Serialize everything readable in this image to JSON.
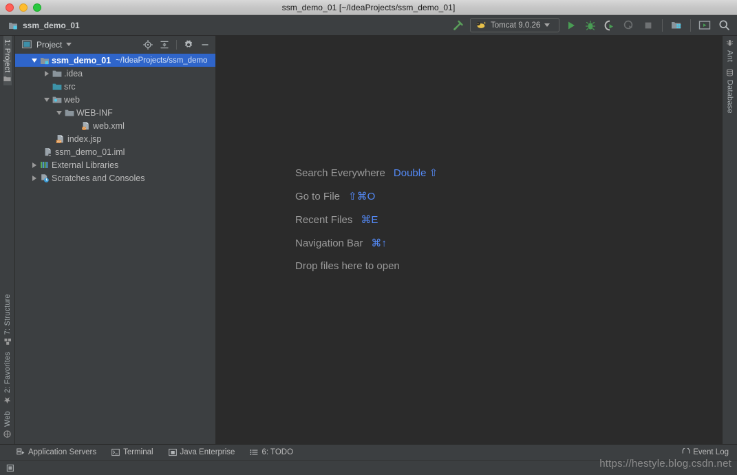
{
  "window": {
    "title": "ssm_demo_01 [~/IdeaProjects/ssm_demo_01]",
    "traffic_lights": [
      "close-red",
      "minimize-yellow",
      "zoom-green"
    ]
  },
  "toolbar": {
    "breadcrumb": "ssm_demo_01",
    "run_config": "Tomcat 9.0.26",
    "icons": [
      "build-hammer-icon",
      "run-icon",
      "debug-icon",
      "run-coverage-icon",
      "profile-icon",
      "stop-icon",
      "project-structure-icon",
      "console-icon",
      "search-icon"
    ]
  },
  "left_stripe": {
    "top": [
      {
        "label": "1: Project",
        "active": true
      }
    ],
    "bottom": [
      {
        "label": "Web"
      },
      {
        "label": "2: Favorites"
      },
      {
        "label": "7: Structure"
      }
    ]
  },
  "right_stripe": {
    "top": [
      {
        "label": "Ant"
      },
      {
        "label": "Database"
      }
    ]
  },
  "project_panel": {
    "title": "Project",
    "header_icons": [
      "locate-target-icon",
      "collapse-all-icon",
      "gear-icon",
      "hide-minimize-icon"
    ],
    "tree": [
      {
        "label": "ssm_demo_01",
        "sub": "~/IdeaProjects/ssm_demo",
        "icon": "module-icon",
        "indent": 0,
        "arrow": "down",
        "selected": true,
        "bold": true
      },
      {
        "label": ".idea",
        "icon": "folder-icon",
        "indent": 1,
        "arrow": "right"
      },
      {
        "label": "src",
        "icon": "source-folder-icon",
        "indent": 1,
        "arrow": "none"
      },
      {
        "label": "web",
        "icon": "web-folder-icon",
        "indent": 1,
        "arrow": "down"
      },
      {
        "label": "WEB-INF",
        "icon": "folder-icon",
        "indent": 2,
        "arrow": "down"
      },
      {
        "label": "web.xml",
        "icon": "xml-file-icon",
        "indent": 3,
        "arrow": "none"
      },
      {
        "label": "index.jsp",
        "icon": "jsp-file-icon",
        "indent": 2,
        "arrow": "none"
      },
      {
        "label": "ssm_demo_01.iml",
        "icon": "iml-file-icon",
        "indent": 1,
        "arrow": "none"
      },
      {
        "label": "External Libraries",
        "icon": "libraries-icon",
        "indent": 0,
        "arrow": "right"
      },
      {
        "label": "Scratches and Consoles",
        "icon": "scratches-icon",
        "indent": 0,
        "arrow": "right"
      }
    ]
  },
  "editor": {
    "hints": [
      {
        "label": "Search Everywhere",
        "key": "Double ⇧"
      },
      {
        "label": "Go to File",
        "key": "⇧⌘O"
      },
      {
        "label": "Recent Files",
        "key": "⌘E"
      },
      {
        "label": "Navigation Bar",
        "key": "⌘↑"
      },
      {
        "label": "Drop files here to open",
        "key": ""
      }
    ]
  },
  "toolwindow_bar": {
    "items": [
      {
        "label": "Application Servers",
        "icon": "application-servers-icon"
      },
      {
        "label": "Terminal",
        "icon": "terminal-icon"
      },
      {
        "label": "Java Enterprise",
        "icon": "java-enterprise-icon"
      },
      {
        "label": "6: TODO",
        "icon": "todo-icon"
      }
    ],
    "event_log": "Event Log"
  },
  "status_bar": {
    "left_icon": "hide-toolwindows-icon"
  },
  "watermark": "https://hestyle.blog.csdn.net",
  "colors": {
    "panel_bg": "#3c3f41",
    "editor_bg": "#2b2b2b",
    "selection_blue": "#2f65ca",
    "accent_link": "#548af7",
    "text": "#bbbbbb",
    "folder_blue": "#7f8b91",
    "source_teal": "#3d9ea8",
    "run_green": "#499c54",
    "orange": "#e08a36"
  }
}
